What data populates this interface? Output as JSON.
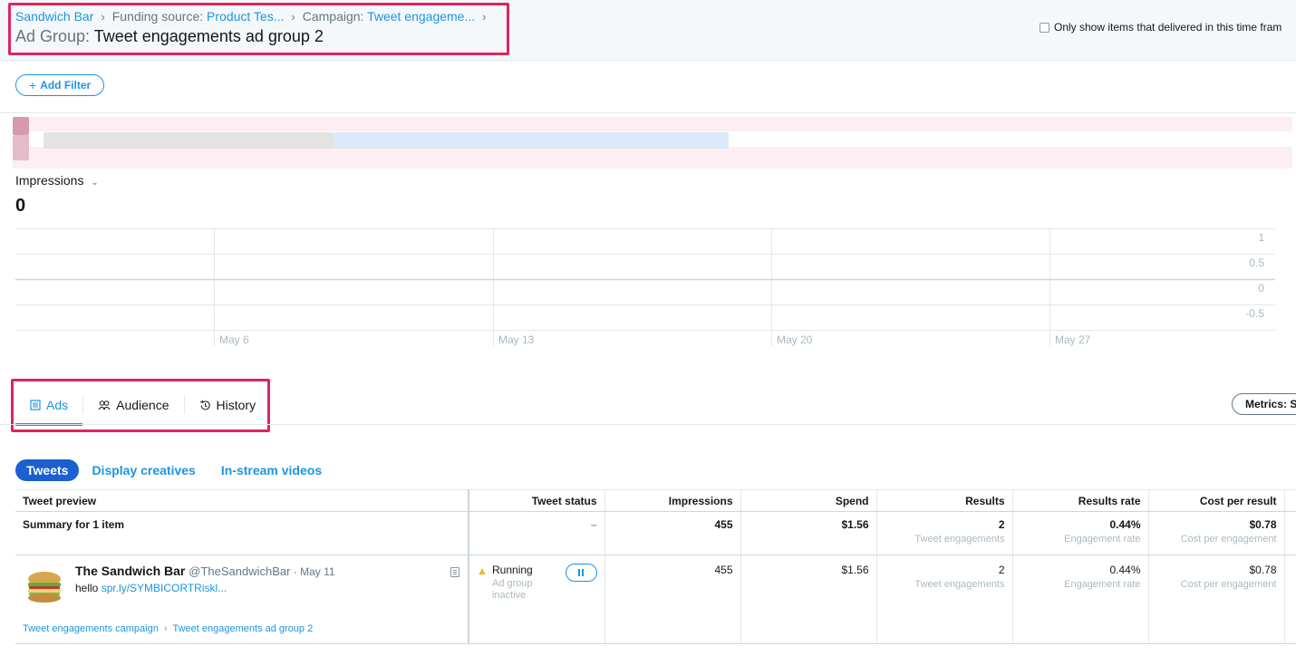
{
  "header": {
    "breadcrumb": {
      "root": "Sandwich Bar",
      "funding_label": "Funding source: ",
      "funding_value": "Product Tes...",
      "campaign_label": "Campaign: ",
      "campaign_value": "Tweet engageme..."
    },
    "adgroup_label": "Ad Group: ",
    "adgroup_value": "Tweet engagements ad group 2",
    "delivered_label": "Only show items that delivered in this time fram"
  },
  "filter": {
    "add_label": "Add Filter"
  },
  "chart": {
    "metric_label": "Impressions",
    "metric_value": "0"
  },
  "chart_data": {
    "type": "line",
    "x": [
      "May 6",
      "May 13",
      "May 20",
      "May 27"
    ],
    "ticks_y": [
      "1",
      "0.5",
      "0",
      "-0.5"
    ],
    "ylim": [
      -0.5,
      1
    ],
    "series": [
      {
        "values": [
          0,
          0,
          0,
          0
        ]
      }
    ],
    "grid": true
  },
  "tabs": [
    {
      "label": "Ads",
      "icon": "list-icon",
      "active": true
    },
    {
      "label": "Audience",
      "icon": "people-icon",
      "active": false
    },
    {
      "label": "History",
      "icon": "history-icon",
      "active": false
    }
  ],
  "metrics_button": "Metrics: S",
  "subtabs": {
    "tweets": "Tweets",
    "display": "Display creatives",
    "instream": "In-stream videos"
  },
  "table": {
    "columns": [
      "Tweet preview",
      "Tweet status",
      "Impressions",
      "Spend",
      "Results",
      "Results rate",
      "Cost per result"
    ],
    "summary": {
      "label": "Summary for 1 item",
      "status": "–",
      "impressions": "455",
      "spend": "$1.56",
      "results": "2",
      "results_sub": "Tweet engagements",
      "rate": "0.44%",
      "rate_sub": "Engagement rate",
      "cost": "$0.78",
      "cost_sub": "Cost per engagement"
    },
    "row": {
      "name": "The Sandwich Bar",
      "handle": "@TheSandwichBar",
      "date": " · May 11",
      "text_prefix": "hello ",
      "text_link": "spr.ly/SYMBICORTRiskl...",
      "crumb_campaign": "Tweet engagements campaign",
      "crumb_adgroup": "Tweet engagements ad group 2",
      "status": "Running",
      "status_sub": "Ad group inactive",
      "impressions": "455",
      "spend": "$1.56",
      "results": "2",
      "results_sub": "Tweet engagements",
      "rate": "0.44%",
      "rate_sub": "Engagement rate",
      "cost": "$0.78",
      "cost_sub": "Cost per engagement"
    }
  },
  "colors": {
    "accent": "#1b95e0",
    "highlight": "#e0245e",
    "pill": "#1b5fd0"
  }
}
